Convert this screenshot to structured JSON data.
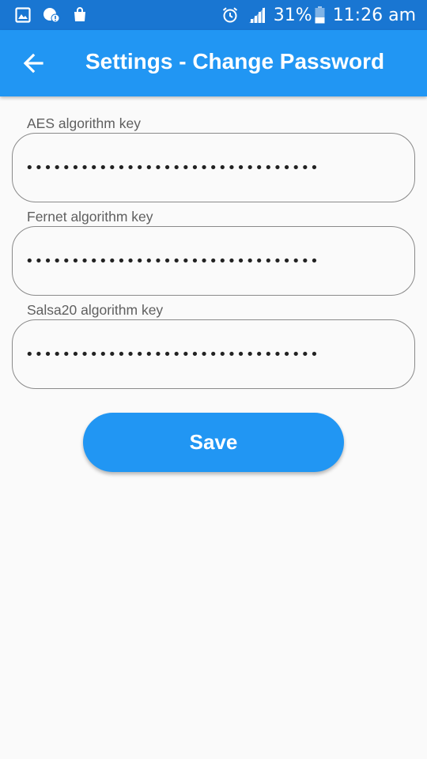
{
  "status_bar": {
    "icons_left": [
      "gallery-icon",
      "chat-alert-icon",
      "shopping-bag-icon"
    ],
    "icons_right": [
      "alarm-icon",
      "signal-icon"
    ],
    "battery_percent": "31%",
    "battery_icon": "battery-icon",
    "time": "11:26 am"
  },
  "app_bar": {
    "back_icon": "arrow-back-icon",
    "title": "Settings - Change Password",
    "color": "#2196f3"
  },
  "form": {
    "fields": [
      {
        "label": "AES algorithm key",
        "value": "••••••••••••••••••••••••••••••••"
      },
      {
        "label": "Fernet algorithm key",
        "value": "••••••••••••••••••••••••••••••••"
      },
      {
        "label": "Salsa20 algorithm key",
        "value": "••••••••••••••••••••••••••••••••"
      }
    ],
    "save_label": "Save"
  }
}
